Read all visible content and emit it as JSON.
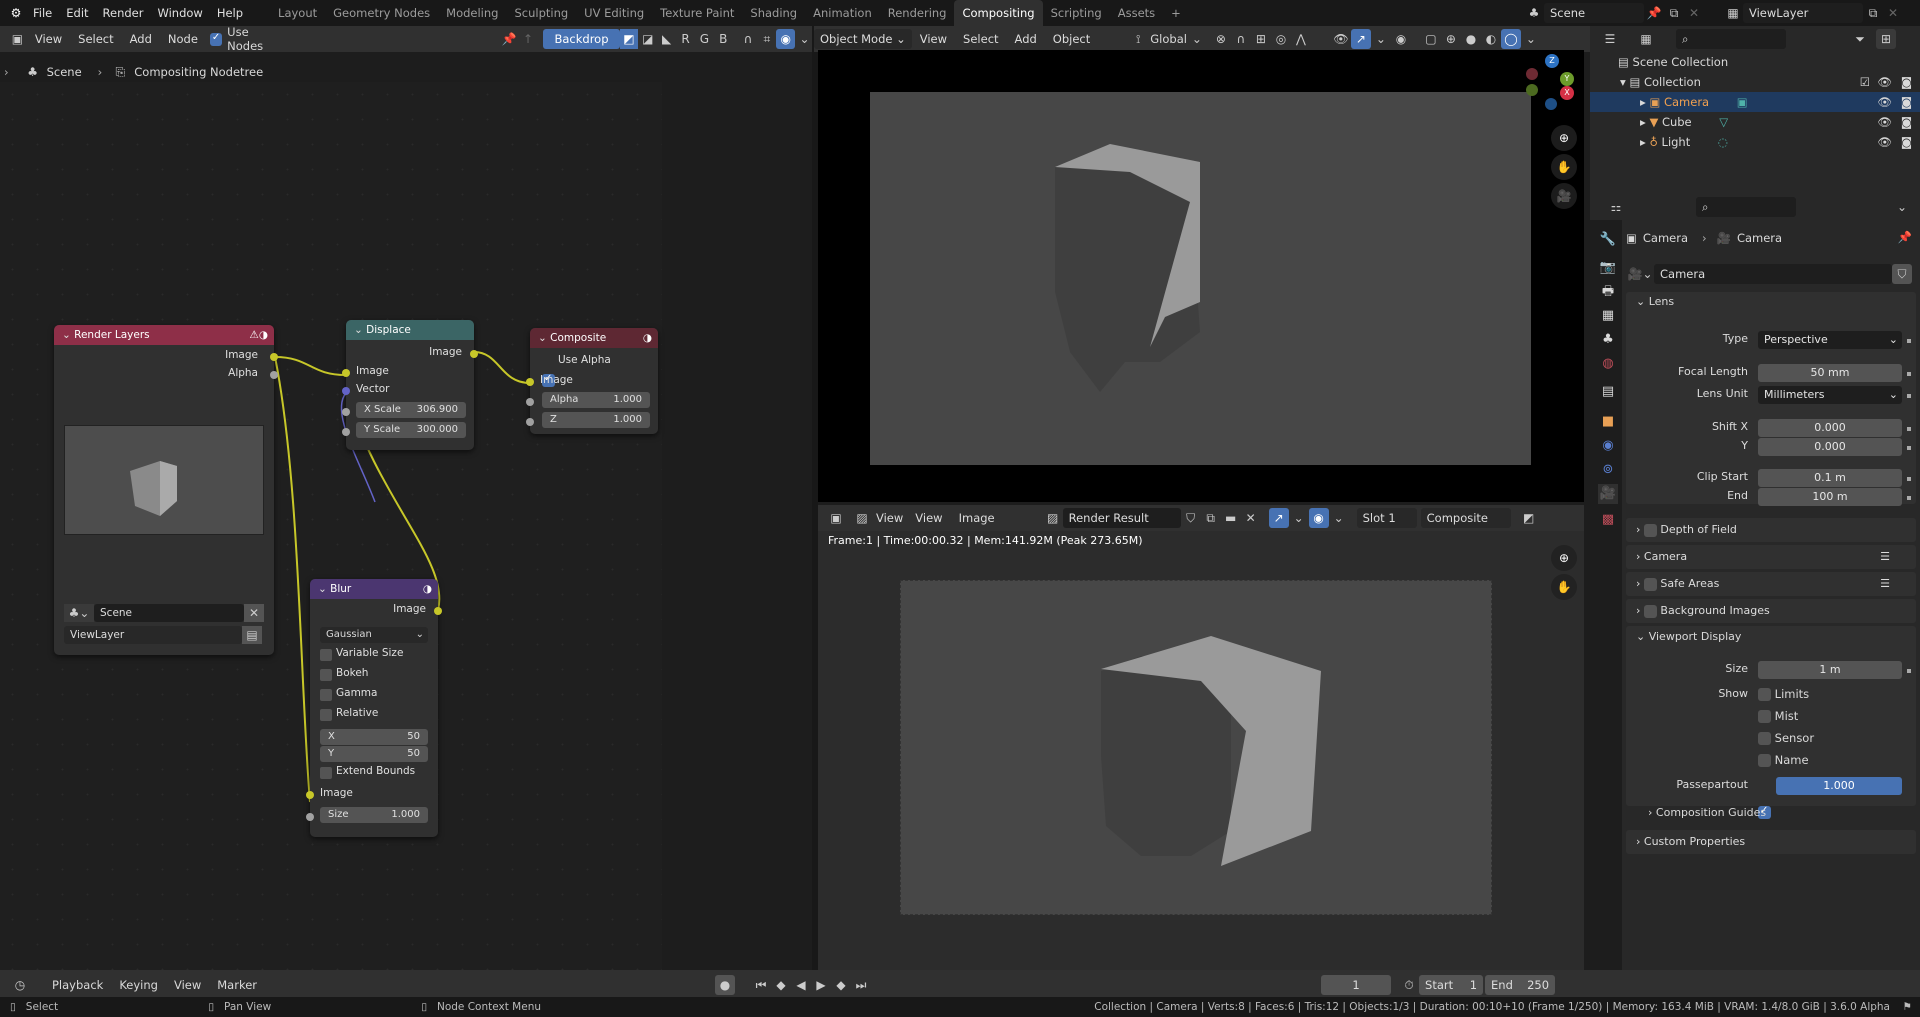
{
  "topbar": {
    "menus": [
      "File",
      "Edit",
      "Render",
      "Window",
      "Help"
    ],
    "workspaces": [
      "Layout",
      "Geometry Nodes",
      "Modeling",
      "Sculpting",
      "UV Editing",
      "Texture Paint",
      "Shading",
      "Animation",
      "Rendering",
      "Compositing",
      "Scripting",
      "Assets"
    ],
    "active_workspace": "Compositing",
    "add_workspace": "+",
    "scene": "Scene",
    "view_layer": "ViewLayer"
  },
  "node_header": {
    "menus": [
      "View",
      "Select",
      "Add",
      "Node"
    ],
    "use_nodes_label": "Use Nodes",
    "use_nodes": true,
    "backdrop_label": "Backdrop",
    "channels": [
      "R",
      "G",
      "B"
    ]
  },
  "breadcrumb": {
    "scene": "Scene",
    "tree": "Compositing Nodetree"
  },
  "nodes": {
    "render_layers": {
      "title": "Render Layers",
      "outputs": [
        "Image",
        "Alpha"
      ],
      "scene": "Scene",
      "view_layer": "ViewLayer",
      "color": "#8e2f48"
    },
    "displace": {
      "title": "Displace",
      "output": "Image",
      "inputs": [
        "Image",
        "Vector"
      ],
      "x_scale_label": "X Scale",
      "x_scale": "306.900",
      "y_scale_label": "Y Scale",
      "y_scale": "300.000",
      "color": "#3b6565"
    },
    "composite": {
      "title": "Composite",
      "use_alpha_label": "Use Alpha",
      "use_alpha": true,
      "input": "Image",
      "alpha_label": "Alpha",
      "alpha": "1.000",
      "z_label": "Z",
      "z": "1.000",
      "color": "#5e2833"
    },
    "blur": {
      "title": "Blur",
      "output": "Image",
      "filter": "Gaussian",
      "options": [
        "Variable Size",
        "Bokeh",
        "Gamma",
        "Relative"
      ],
      "x_label": "X",
      "x": "50",
      "y_label": "Y",
      "y": "50",
      "extend_bounds": "Extend Bounds",
      "input": "Image",
      "size_label": "Size",
      "size": "1.000",
      "color": "#4b3670"
    }
  },
  "view3d_header": {
    "mode": "Object Mode",
    "menus": [
      "View",
      "Select",
      "Add",
      "Object"
    ],
    "orientation": "Global"
  },
  "gizmo": {
    "z": "Z",
    "y": "Y",
    "x": "X"
  },
  "image_editor": {
    "menus": [
      "View",
      "View",
      "Image"
    ],
    "image_name": "Render Result",
    "slot": "Slot 1",
    "layer": "Composite",
    "render_info": "Frame:1 | Time:00:00.32 | Mem:141.92M (Peak 273.65M)"
  },
  "outliner": {
    "root": "Scene Collection",
    "collection": "Collection",
    "items": [
      {
        "name": "Camera",
        "selected": true
      },
      {
        "name": "Cube",
        "selected": false
      },
      {
        "name": "Light",
        "selected": false
      }
    ]
  },
  "properties": {
    "breadcrumb": [
      "Camera",
      "Camera"
    ],
    "datablock": "Camera",
    "lens": {
      "title": "Lens",
      "type_label": "Type",
      "type": "Perspective",
      "focal_label": "Focal Length",
      "focal": "50 mm",
      "unit_label": "Lens Unit",
      "unit": "Millimeters",
      "shiftx_label": "Shift X",
      "shiftx": "0.000",
      "shifty_label": "Y",
      "shifty": "0.000",
      "clipstart_label": "Clip Start",
      "clipstart": "0.1 m",
      "clipend_label": "End",
      "clipend": "100 m"
    },
    "panels": [
      "Depth of Field",
      "Camera",
      "Safe Areas",
      "Background Images"
    ],
    "viewport_display": {
      "title": "Viewport Display",
      "size_label": "Size",
      "size": "1 m",
      "show_label": "Show",
      "show_options": [
        "Limits",
        "Mist",
        "Sensor",
        "Name"
      ],
      "passepartout_label": "Passepartout",
      "passepartout": "1.000",
      "composition_guides": "Composition Guides"
    },
    "custom_properties": "Custom Properties"
  },
  "timeline": {
    "menus": [
      "Playback",
      "Keying",
      "View",
      "Marker"
    ],
    "current_frame": "1",
    "start_label": "Start",
    "start": "1",
    "end_label": "End",
    "end": "250"
  },
  "status": {
    "select": "Select",
    "pan": "Pan View",
    "context": "Node Context Menu",
    "info": "Collection | Camera | Verts:8 | Faces:6 | Tris:12 | Objects:1/3 | Duration: 00:10+10 (Frame 1/250) | Memory: 163.4 MiB | VRAM: 1.4/8.0 GiB | 3.6.0 Alpha"
  }
}
